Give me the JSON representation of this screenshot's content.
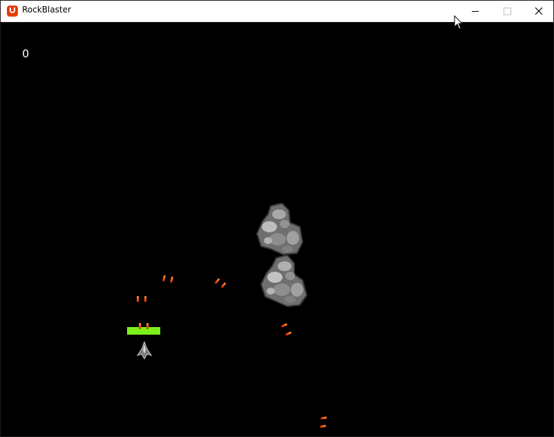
{
  "window": {
    "title": "RockBlaster",
    "controls": [
      "minimize",
      "maximize",
      "close"
    ]
  },
  "game": {
    "score": "0",
    "health_fraction": 1.0,
    "colors": {
      "background": "#000000",
      "health_bar": "#7bf01e",
      "bullet": "#e02000",
      "rock": "#8a8a8a"
    },
    "sprites": [
      "player-ship",
      "rock",
      "rock",
      "bullet-pairs"
    ]
  }
}
